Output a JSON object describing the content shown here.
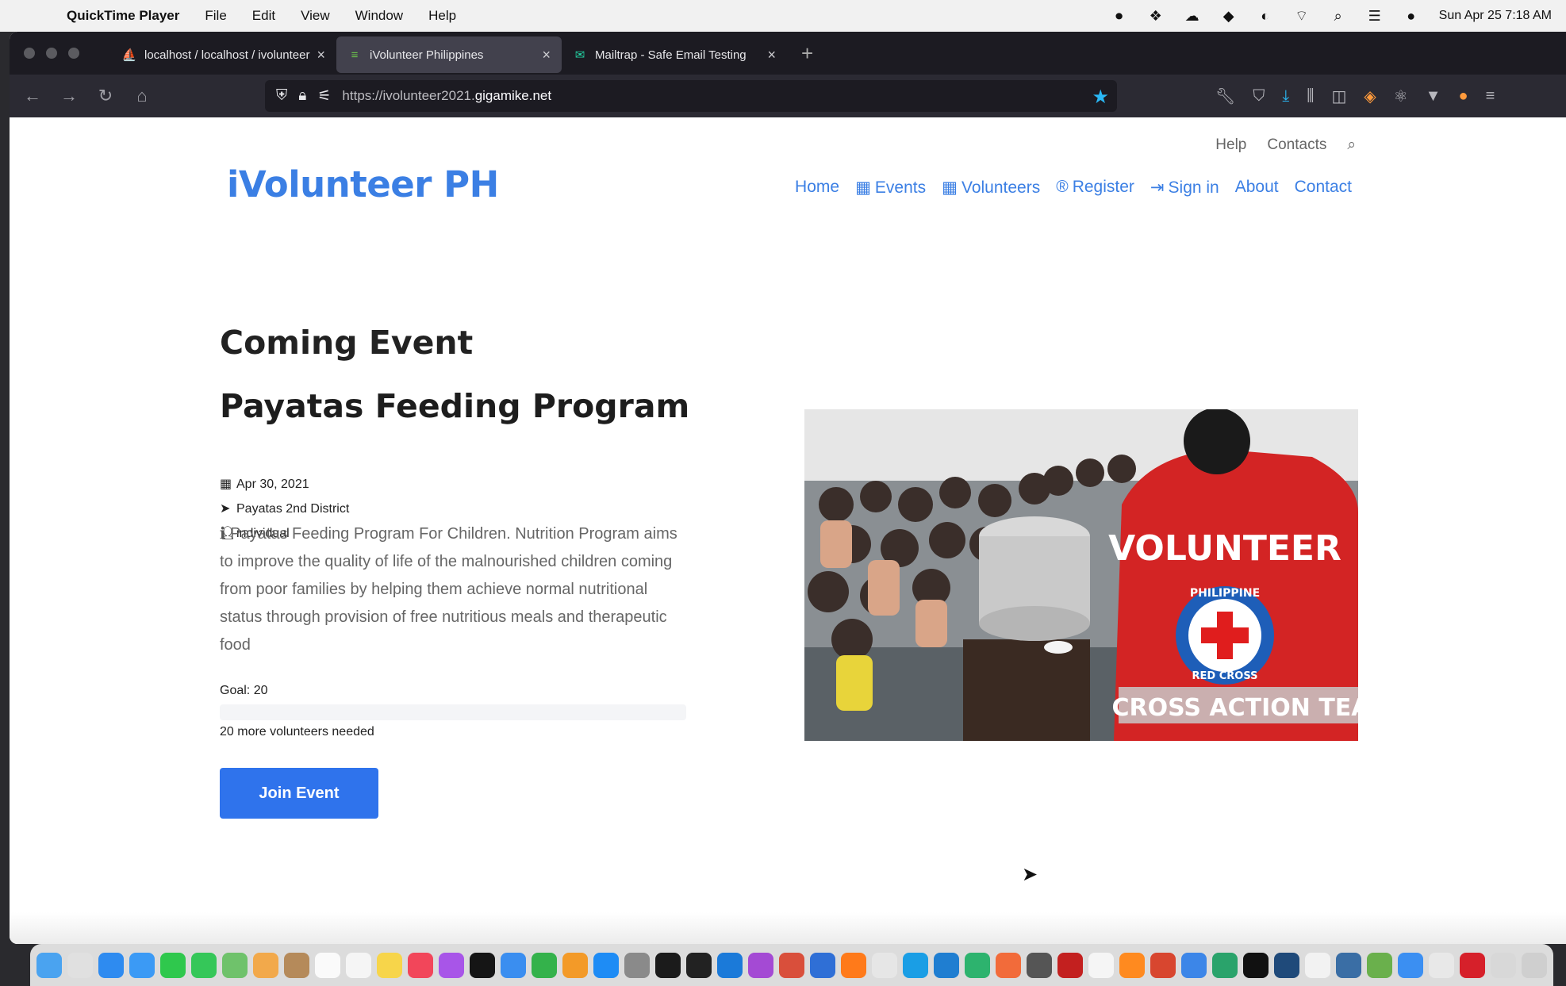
{
  "menubar": {
    "app_name": "QuickTime Player",
    "menus": [
      "File",
      "Edit",
      "View",
      "Window",
      "Help"
    ],
    "clock": "Sun Apr 25  7:18 AM"
  },
  "browser": {
    "tabs": [
      {
        "title": "localhost / localhost / ivolunteer",
        "favicon": "phpmyadmin-icon"
      },
      {
        "title": "iVolunteer Philippines",
        "favicon": "site-icon",
        "active": true
      },
      {
        "title": "Mailtrap - Safe Email Testing",
        "favicon": "mailtrap-icon"
      }
    ],
    "url_prefix": "https://ivolunteer2021.",
    "url_host": "gigamike.net"
  },
  "site": {
    "top_links": [
      "Help",
      "Contacts"
    ],
    "brand": "iVolunteer PH",
    "nav": [
      "Home",
      "Events",
      "Volunteers",
      "Register",
      "Sign in",
      "About",
      "Contact"
    ]
  },
  "event": {
    "section_title": "Coming Event",
    "name": "Payatas Feeding Program",
    "date": "Apr 30, 2021",
    "location": "Payatas 2nd District",
    "type": "individual",
    "description": "Payatas Feeding Program For Children. Nutrition Program aims to improve the quality of life of the malnourished children coming from poor families by helping them achieve normal nutritional status through provision of free nutritious meals and therapeutic food",
    "goal": "Goal: 20",
    "progress_percent": 0,
    "needed": "20 more volunteers needed",
    "join_label": "Join Event"
  },
  "photo": {
    "vest_text": "VOLUNTEER",
    "badge_top": "PHILIPPINE",
    "badge_bottom": "RED CROSS",
    "band_text": "CROSS ACTION TEA"
  },
  "colors": {
    "accent": "#3b7fe4",
    "button": "#2f73ec"
  }
}
